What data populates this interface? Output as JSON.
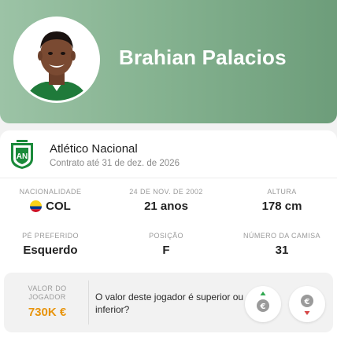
{
  "player": {
    "name": "Brahian Palacios"
  },
  "club": {
    "name": "Atlético Nacional",
    "contract": "Contrato até 31 de dez. de 2026"
  },
  "stats": {
    "nationality_label": "NACIONALIDADE",
    "nationality_value": "COL",
    "birth_label": "24 DE NOV. DE 2002",
    "birth_value": "21 anos",
    "height_label": "ALTURA",
    "height_value": "178 cm",
    "foot_label": "PÉ PREFERIDO",
    "foot_value": "Esquerdo",
    "position_label": "POSIÇÃO",
    "position_value": "F",
    "shirt_label": "NÚMERO DA CAMISA",
    "shirt_value": "31"
  },
  "market_value": {
    "label": "VALOR DO JOGADOR",
    "amount": "730K €",
    "question": "O valor deste jogador é superior ou inferior?",
    "up_icon": "euro-up-icon",
    "down_icon": "euro-down-icon"
  },
  "colors": {
    "header_green": "#86b391",
    "club_green": "#1a8a3a",
    "value_orange": "#e8940c",
    "up_green": "#2fa84f",
    "down_red": "#d64545"
  }
}
